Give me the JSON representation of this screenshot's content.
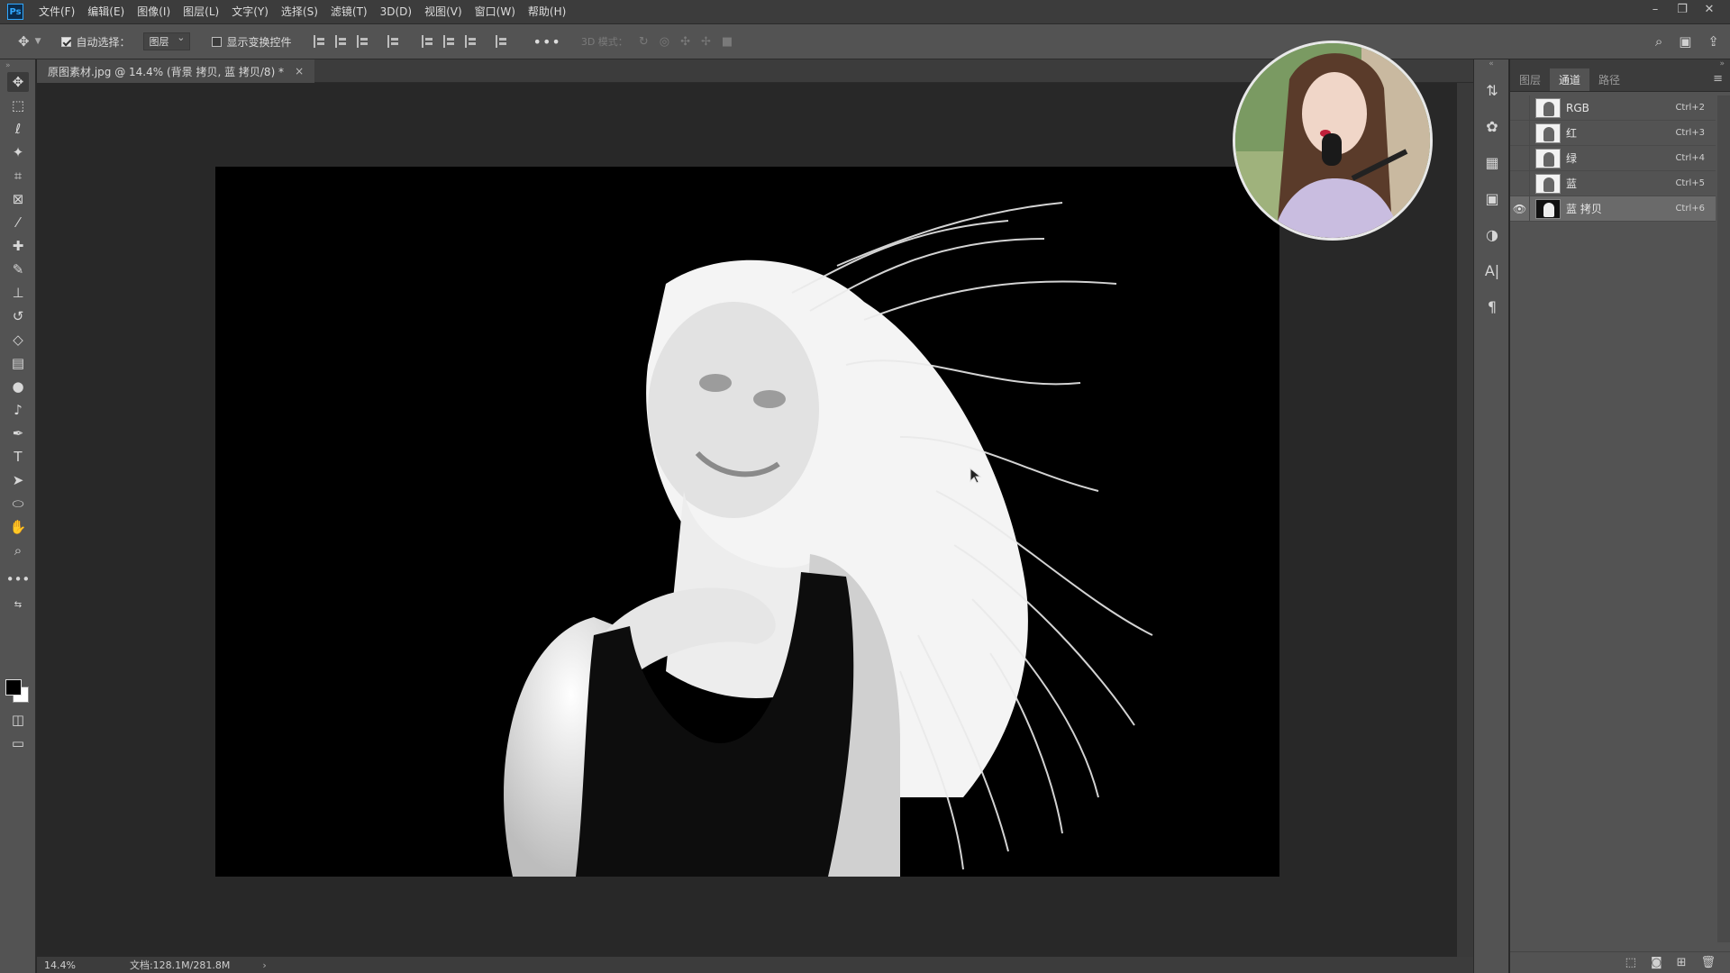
{
  "app": {
    "logo": "Ps",
    "menu": [
      "文件(F)",
      "编辑(E)",
      "图像(I)",
      "图层(L)",
      "文字(Y)",
      "选择(S)",
      "滤镜(T)",
      "3D(D)",
      "视图(V)",
      "窗口(W)",
      "帮助(H)"
    ],
    "window_controls": [
      "–",
      "❐",
      "✕"
    ]
  },
  "options_bar": {
    "move_icon": "move-icon",
    "auto_select_label": "自动选择：",
    "auto_select_checked": true,
    "auto_select_target": "图层",
    "show_transform_label": "显示变换控件",
    "show_transform_checked": false,
    "more": "•••",
    "mode_3d_label": "3D 模式："
  },
  "document": {
    "tab_title": "原图素材.jpg @ 14.4% (背景 拷贝, 蓝 拷贝/8) *",
    "close": "×",
    "zoom": "14.4%",
    "doc_info": "文档:128.1M/281.8M",
    "status_arrow": "›"
  },
  "channels_panel": {
    "tabs": [
      "图层",
      "通道",
      "路径"
    ],
    "active_tab": "通道",
    "menu_icon": "≡",
    "channels": [
      {
        "name": "RGB",
        "shortcut": "Ctrl+2",
        "visible": false,
        "selected": false
      },
      {
        "name": "红",
        "shortcut": "Ctrl+3",
        "visible": false,
        "selected": false
      },
      {
        "name": "绿",
        "shortcut": "Ctrl+4",
        "visible": false,
        "selected": false
      },
      {
        "name": "蓝",
        "shortcut": "Ctrl+5",
        "visible": false,
        "selected": false
      },
      {
        "name": "蓝 拷贝",
        "shortcut": "Ctrl+6",
        "visible": true,
        "selected": true
      }
    ]
  },
  "colors": {
    "foreground": "#000000",
    "background": "#ffffff",
    "ui_dark": "#282828",
    "ui_panel": "#535353"
  }
}
